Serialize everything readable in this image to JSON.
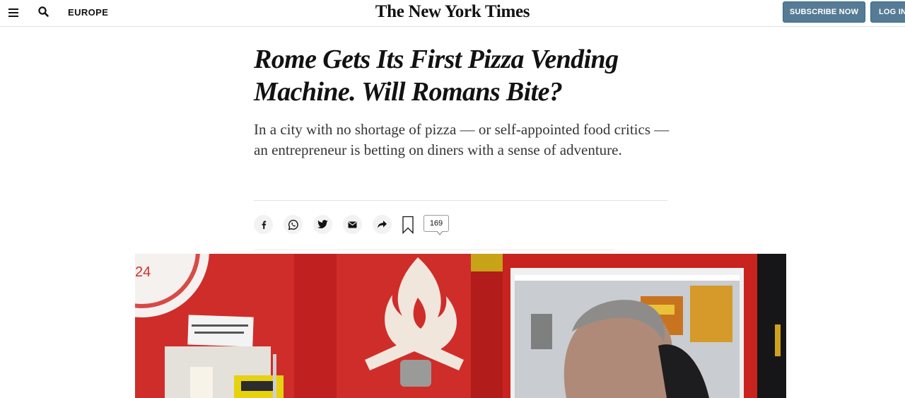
{
  "header": {
    "menu_icon": "hamburger-menu-icon",
    "search_icon": "search-icon",
    "section_label": "EUROPE",
    "logo_text": "The New York Times",
    "subscribe_label": "SUBSCRIBE NOW",
    "login_label": "LOG IN",
    "button_color": "#567b95"
  },
  "article": {
    "headline": "Rome Gets Its First Pizza Vending Machine. Will Romans Bite?",
    "summary": "In a city with no shortage of pizza — or self-appointed food critics — an entrepreneur is betting on diners with a sense of adventure.",
    "comment_count": "169"
  },
  "share_tools": [
    {
      "name": "facebook",
      "icon": "facebook-icon"
    },
    {
      "name": "whatsapp",
      "icon": "whatsapp-icon"
    },
    {
      "name": "twitter",
      "icon": "twitter-icon"
    },
    {
      "name": "email",
      "icon": "email-icon"
    },
    {
      "name": "share",
      "icon": "share-arrow-icon"
    },
    {
      "name": "save",
      "icon": "bookmark-icon"
    }
  ],
  "lead_image": {
    "description_icon": "photo-pizza-vending-machine",
    "sign_text": "24",
    "accent_color": "#d0312d"
  }
}
